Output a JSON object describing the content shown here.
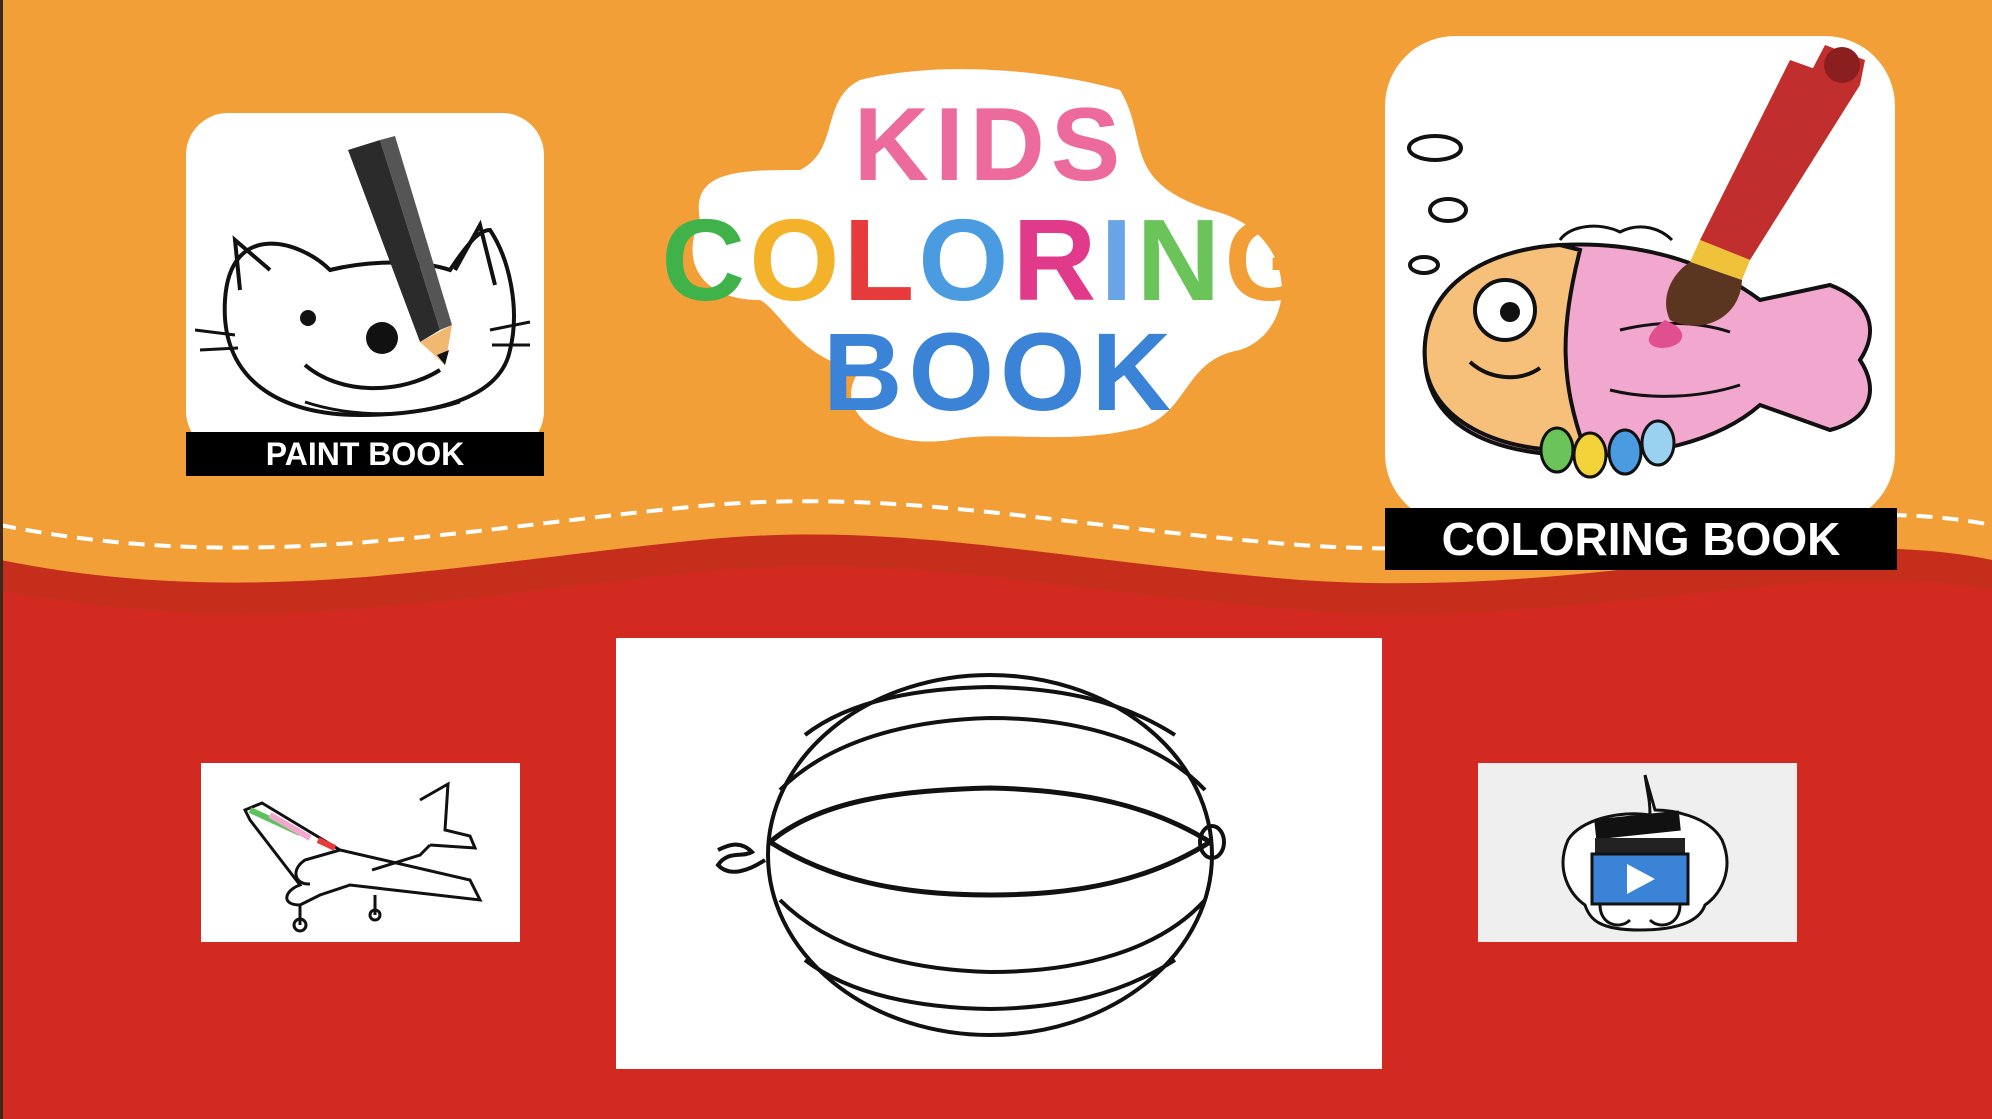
{
  "title": {
    "line1": "KIDS",
    "line2": "COLORING",
    "line3": "BOOK"
  },
  "apps": {
    "paint_book": {
      "label": "PAINT BOOK",
      "icon": "cat-drawing-pencil-icon"
    },
    "coloring_book": {
      "label": "COLORING BOOK",
      "icon": "fish-painting-brush-icon"
    }
  },
  "thumbnails": {
    "left": {
      "icon": "airplane-drawing"
    },
    "center": {
      "icon": "watermelon-outline"
    },
    "right": {
      "icon": "video-clapper-play-icon"
    }
  },
  "colors": {
    "orange": "#f29f38",
    "red": "#d22a20",
    "pink": "#ec6a9c",
    "blue": "#3a83d6",
    "green": "#5cc25a",
    "black_label": "#000000"
  },
  "title_colors": {
    "line1": [
      "#ec6a9c",
      "#ec6a9c",
      "#ec6a9c",
      "#ec6a9c"
    ],
    "line2": [
      "#3fb24a",
      "#f4b22a",
      "#e73a3a",
      "#4a9be0",
      "#e23a8a",
      "#6aa3e6",
      "#6ac45a",
      "#f29f38"
    ],
    "line3": [
      "#3a83d6",
      "#3a83d6",
      "#3a83d6",
      "#3a83d6"
    ]
  }
}
